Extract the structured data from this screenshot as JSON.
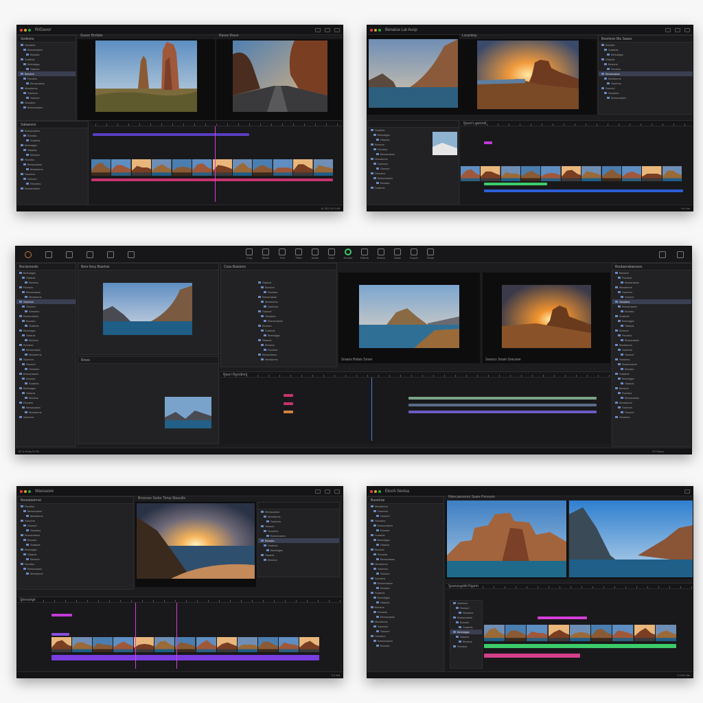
{
  "colors": {
    "accent_green": "#3ccc6a",
    "accent_purple": "#8a4ee0",
    "accent_magenta": "#d43fd8",
    "accent_pink": "#c7346e",
    "accent_blue": "#2c5fd6",
    "selection": "#3a3f52"
  },
  "icons": [
    "close-dot-icon",
    "minimize-dot-icon",
    "zoom-dot-icon",
    "folder-icon",
    "film-icon",
    "play-icon",
    "scissors-icon",
    "gear-icon",
    "search-icon"
  ],
  "window1": {
    "title": "Ri/Davor",
    "viewer_left_title": "Suave Brofabs",
    "viewer_right_title": "Raxse Brave",
    "timeline_label": "Sabaeons",
    "browser_label": "Sedioms",
    "status": "14 35 2:10 2:69"
  },
  "window2": {
    "title": "Benaisa Lat Ausp",
    "viewer_title": "Loracbiay",
    "inspector_title": "Boorlorer Bts Sases",
    "timeline_label": "Ruosl Laarsroll",
    "status": "Ko Lan"
  },
  "window3": {
    "browser_title": "Bocisisreolis",
    "source_title": "Bere fiosy Basrlow",
    "project_title": "Coss Basioms",
    "inspector_title": "Boubarrabaeuses",
    "timeline_title": "Raorr Rsordionl",
    "effects_title": "Rnosi",
    "viewer1_caption": "Sraans Bslats Srowr",
    "viewer2_caption": "Seaocs Snaie Sracowe",
    "status_left": "BT & Pons R Fl6",
    "status_right": "ST Paure"
  },
  "window4": {
    "title": "Waosaore",
    "viewer_title": "Broorsse Sorbs Tbrvp Sbacolle",
    "library_title": "Bearatanirnal",
    "timeline_label": "Sleoramal",
    "status": "2.3 Wa"
  },
  "window5": {
    "title": "Ekv/A Sevisa",
    "viewer_title": "Nlencaensmor Ssare Porvsom",
    "library_title": "Buoerras",
    "timeline_label": "Ssaruscarbit Rsarm",
    "status": "1.0 Bo Nio"
  },
  "toolbar": {
    "tools": [
      "Crop",
      "Blade",
      "Trim",
      "Titles",
      "Audio",
      "Color",
      "Render",
      "Effects",
      "Motion",
      "Mask",
      "Export",
      "Share"
    ]
  },
  "tree_items": [
    "Sesstms",
    "Bnesmaslen",
    "Borasio",
    "Sualeds",
    "Berbalgss",
    "Staauls",
    "Bendoe",
    "Rooslss",
    "Bersauasss",
    "Meadoens",
    "Saortors",
    "Saosorl"
  ]
}
